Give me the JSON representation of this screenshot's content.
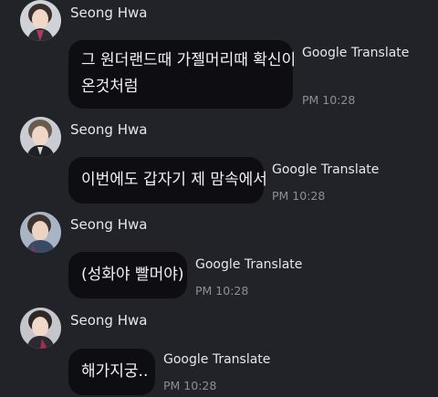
{
  "messages": [
    {
      "sender": "Seong Hwa",
      "lines": [
        "그 원더랜드때 가젤머리때 확신이",
        "온것처럼"
      ],
      "translate_label": "Google Translate",
      "time": "PM 10:28"
    },
    {
      "sender": "Seong Hwa",
      "lines": [
        "이번에도 갑자기 제 맘속에서"
      ],
      "translate_label": "Google Translate",
      "time": "PM 10:28"
    },
    {
      "sender": "Seong Hwa",
      "lines": [
        "(성화야 빨머야)"
      ],
      "translate_label": "Google Translate",
      "time": "PM 10:28"
    },
    {
      "sender": "Seong Hwa",
      "lines": [
        "해가지궁.."
      ],
      "translate_label": "Google Translate",
      "time": "PM 10:28"
    }
  ],
  "icons": {
    "avatar": "profile-photo"
  },
  "colors": {
    "background": "#222229",
    "bubble": "#0e0e12",
    "text": "#f2f2f4",
    "muted": "#8e8e98"
  }
}
